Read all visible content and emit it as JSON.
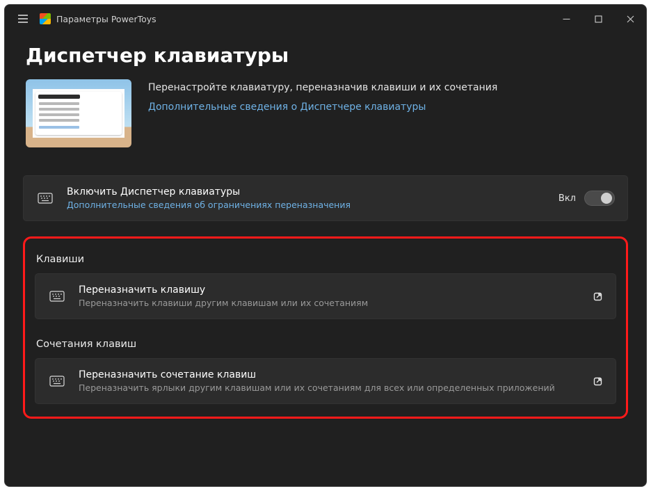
{
  "window": {
    "title": "Параметры PowerToys"
  },
  "page": {
    "heading": "Диспетчер клавиатуры",
    "intro_description": "Перенастройте клавиатуру, переназначив клавиши и их сочетания",
    "intro_link": "Дополнительные сведения о Диспетчере клавиатуры"
  },
  "enable_card": {
    "title": "Включить Диспетчер клавиатуры",
    "subtitle": "Дополнительные сведения об ограничениях переназначения",
    "state_label": "Вкл",
    "enabled": true
  },
  "sections": {
    "keys": {
      "header": "Клавиши",
      "item_title": "Переназначить клавишу",
      "item_subtitle": "Переназначить клавиши другим клавишам или их сочетаниям"
    },
    "shortcuts": {
      "header": "Сочетания клавиш",
      "item_title": "Переназначить сочетание клавиш",
      "item_subtitle": "Переназначить ярлыки другим клавишам или их сочетаниям для всех или определенных приложений"
    }
  }
}
